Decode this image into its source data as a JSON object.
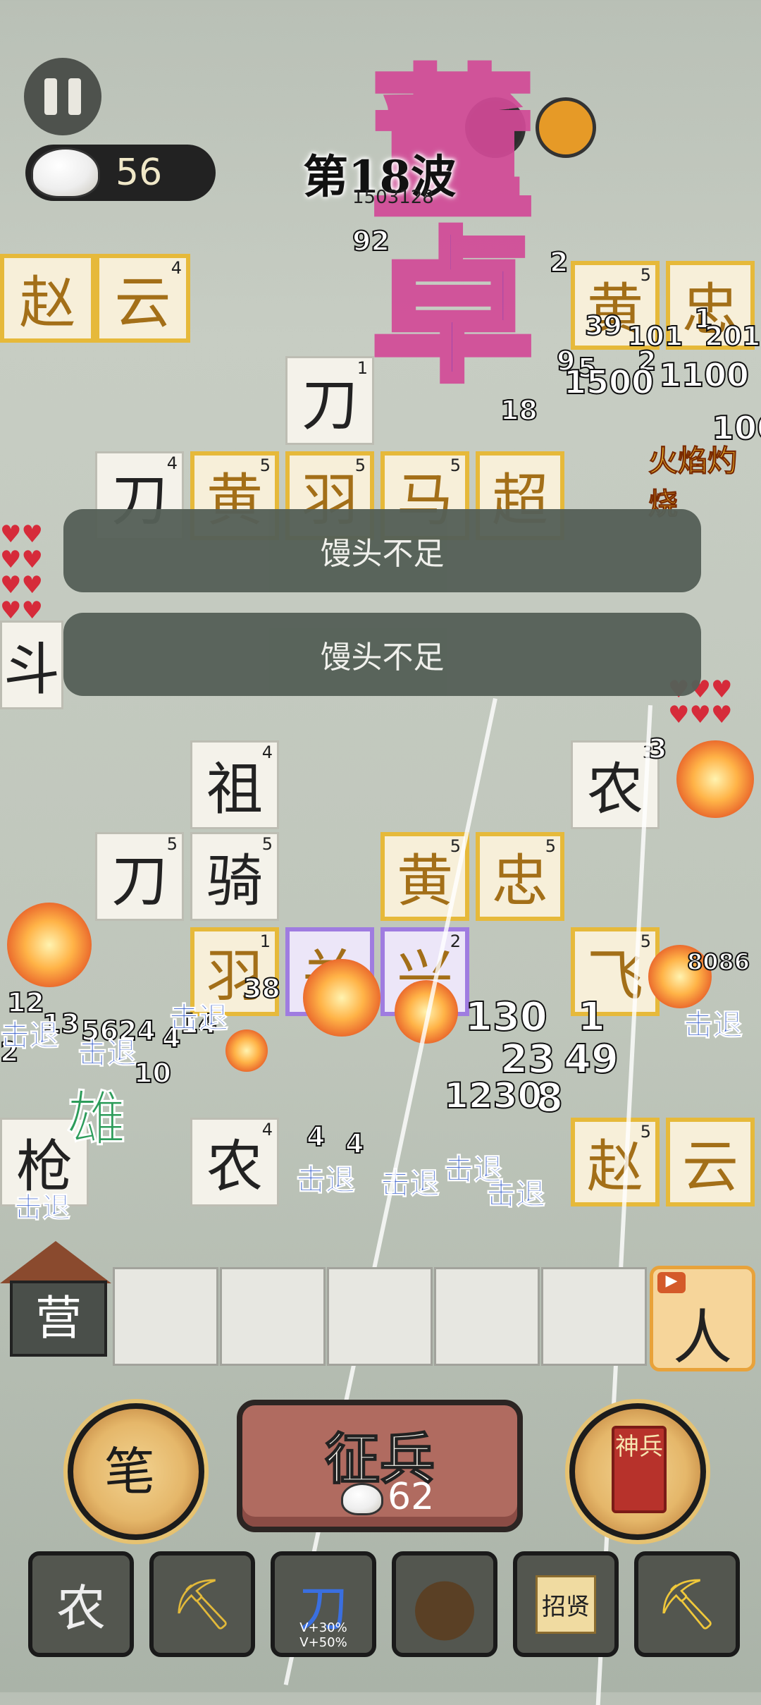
{
  "hud": {
    "pause_icon": "pause-icon",
    "mantou_count": "56",
    "wave_label": "第18波",
    "boss_name": "董卓",
    "boss_hp_text": "1503128"
  },
  "board": {
    "tiles": [
      {
        "text": "赵",
        "lv": "",
        "style": "gold"
      },
      {
        "text": "云",
        "lv": "4",
        "style": "gold"
      },
      {
        "text": "刀",
        "lv": "1",
        "style": "plain"
      },
      {
        "text": "刀",
        "lv": "4",
        "style": "plain"
      },
      {
        "text": "黄",
        "lv": "5",
        "style": "gold"
      },
      {
        "text": "羽",
        "lv": "5",
        "style": "gold"
      },
      {
        "text": "马",
        "lv": "5",
        "style": "gold"
      },
      {
        "text": "超",
        "lv": "",
        "style": "gold"
      },
      {
        "text": "黄",
        "lv": "5",
        "style": "gold"
      },
      {
        "text": "忠",
        "lv": "",
        "style": "gold"
      },
      {
        "text": "祖",
        "lv": "4",
        "style": "plain"
      },
      {
        "text": "农",
        "lv": "3",
        "style": "plain"
      },
      {
        "text": "刀",
        "lv": "5",
        "style": "plain"
      },
      {
        "text": "骑",
        "lv": "5",
        "style": "plain"
      },
      {
        "text": "黄",
        "lv": "5",
        "style": "gold"
      },
      {
        "text": "忠",
        "lv": "5",
        "style": "gold"
      },
      {
        "text": "羽",
        "lv": "1",
        "style": "gold"
      },
      {
        "text": "关",
        "lv": "",
        "style": "purple"
      },
      {
        "text": "兴",
        "lv": "2",
        "style": "purple"
      },
      {
        "text": "飞",
        "lv": "5",
        "style": "gold"
      },
      {
        "text": "枪",
        "lv": "",
        "style": "plain"
      },
      {
        "text": "农",
        "lv": "4",
        "style": "plain"
      },
      {
        "text": "赵",
        "lv": "5",
        "style": "gold"
      },
      {
        "text": "云",
        "lv": "",
        "style": "gold"
      },
      {
        "text": "斗",
        "lv": "",
        "style": "plain"
      }
    ],
    "damage_numbers": [
      "92",
      "2",
      "18",
      "39",
      "1",
      "101",
      "2",
      "201",
      "9",
      "5",
      "1500",
      "1100",
      "100",
      "8086",
      "130",
      "1",
      "23",
      "49",
      "12",
      "13",
      "5624",
      "10",
      "8",
      "2",
      "14",
      "4",
      "38",
      "1230",
      "4",
      "4",
      "3"
    ],
    "effect_text": "火焰灼烧",
    "knockback_label": "击退",
    "hero_tag": "雄"
  },
  "toasts": [
    "馒头不足",
    "馒头不足"
  ],
  "bottom": {
    "camp_label": "营",
    "bench_slots": 5,
    "ad_card_label": "人",
    "ad_tag": "▶",
    "brush_label": "笔",
    "recruit_label": "征兵",
    "recruit_cost": "62",
    "shenbing_label": "神兵"
  },
  "toolbar": [
    {
      "name": "farmer-tool",
      "text": "农",
      "sub": ""
    },
    {
      "name": "shovel-tool",
      "text": "⛏",
      "sub": ""
    },
    {
      "name": "blade-upgrade-tool",
      "text": "刀",
      "sub": "V+30%  V+50%"
    },
    {
      "name": "rock-tool",
      "text": "●",
      "sub": ""
    },
    {
      "name": "zhaoxian-tool",
      "text": "招贤",
      "sub": ""
    },
    {
      "name": "treasure-dig-tool",
      "text": "⛏",
      "sub": ""
    }
  ]
}
